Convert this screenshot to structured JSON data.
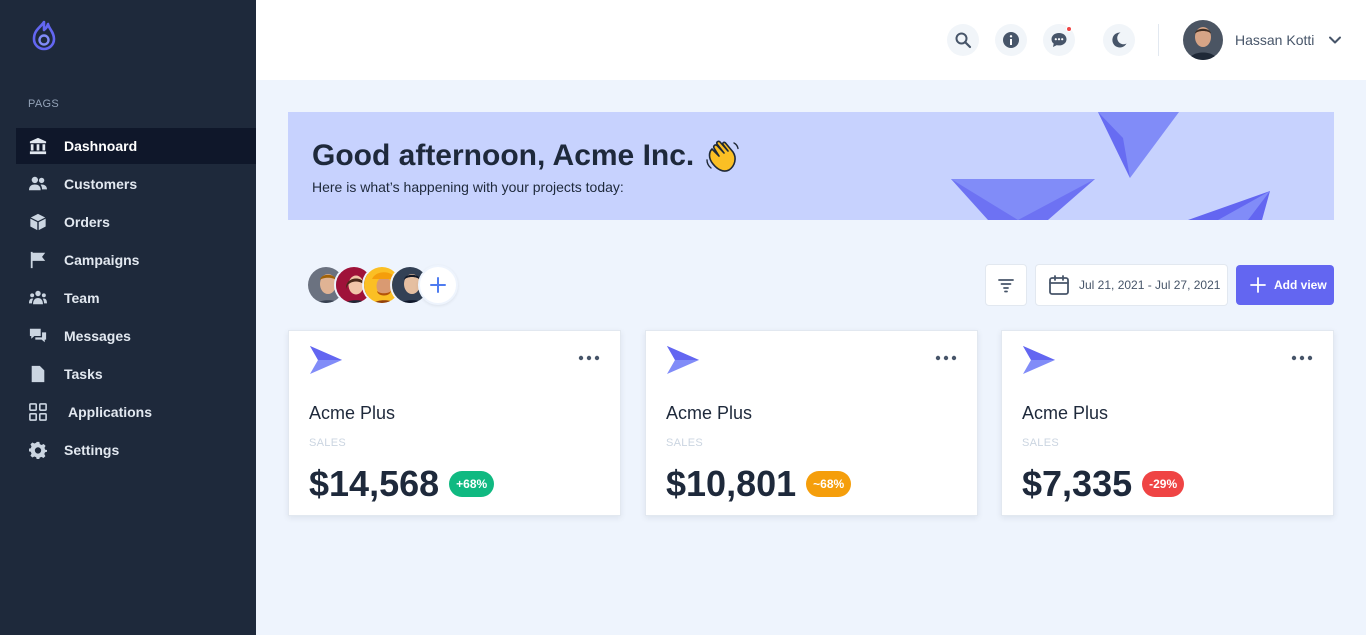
{
  "sidebar": {
    "section_label": "PAGS",
    "items": [
      {
        "label": "Dashnoard",
        "icon": "bank-icon",
        "active": true
      },
      {
        "label": "Customers",
        "icon": "users-icon"
      },
      {
        "label": "Orders",
        "icon": "box-icon"
      },
      {
        "label": "Campaigns",
        "icon": "flag-icon"
      },
      {
        "label": "Team",
        "icon": "team-icon"
      },
      {
        "label": "Messages",
        "icon": "chat-icon"
      },
      {
        "label": "Tasks",
        "icon": "document-icon"
      },
      {
        "label": "Applications",
        "icon": "grid-icon"
      },
      {
        "label": "Settings",
        "icon": "gear-icon"
      }
    ]
  },
  "header": {
    "user_name": "Hassan Kotti",
    "icons": [
      "search-icon",
      "info-icon",
      "chat-bubble-icon",
      "moon-icon"
    ]
  },
  "banner": {
    "title": "Good afternoon, Acme Inc.",
    "subtitle": "Here is what’s happening with your projects today:"
  },
  "toolbar": {
    "date_range": "Jul 21, 2021 - Jul 27, 2021",
    "add_view_label": "Add view"
  },
  "cards": [
    {
      "name": "Acme Plus",
      "label": "SALES",
      "amount": "$14,568",
      "badge": "+68%",
      "badge_color": "#10b981"
    },
    {
      "name": "Acme Plus",
      "label": "SALES",
      "amount": "$10,801",
      "badge": "~68%",
      "badge_color": "#f59e0b"
    },
    {
      "name": "Acme Plus",
      "label": "SALES",
      "amount": "$7,335",
      "badge": "-29%",
      "badge_color": "#ef4444"
    }
  ],
  "colors": {
    "sidebar_bg": "#1e293b",
    "accent": "#6366f1",
    "banner_bg": "#c7d2fe",
    "page_bg": "#eef4fd"
  }
}
